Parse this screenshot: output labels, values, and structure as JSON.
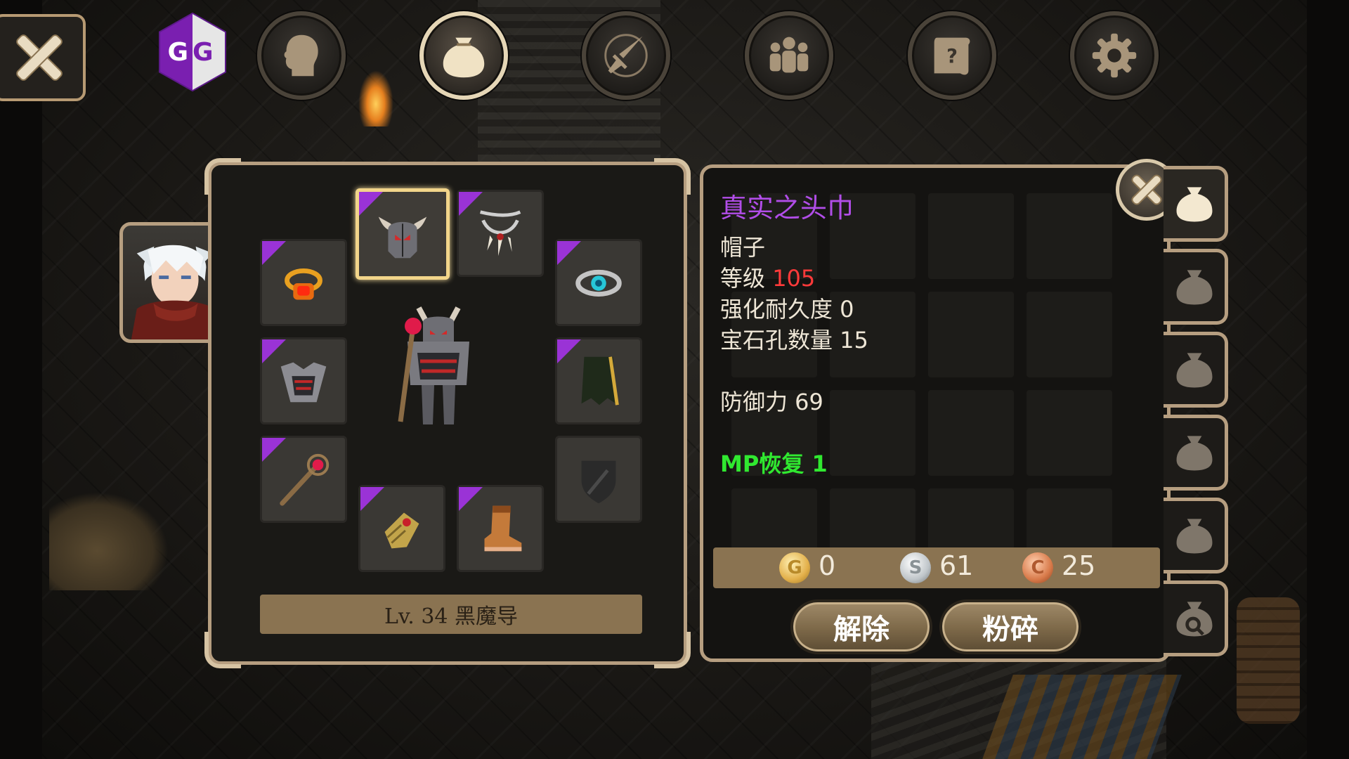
{
  "top_bar": {
    "logo_text_left": "G",
    "logo_text_right": "G",
    "tabs": [
      {
        "icon": "head-icon",
        "active": false
      },
      {
        "icon": "bag-icon",
        "active": true
      },
      {
        "icon": "sword-compass-icon",
        "active": false
      },
      {
        "icon": "party-icon",
        "active": false
      },
      {
        "icon": "quest-scroll-icon",
        "active": false
      },
      {
        "icon": "gear-icon",
        "active": false
      }
    ]
  },
  "equipment": {
    "class_label": "Lv. 34 黑魔导",
    "slots": [
      {
        "name": "helmet",
        "icon": "horned-helmet-icon",
        "rarity": "epic",
        "selected": true
      },
      {
        "name": "necklace",
        "icon": "claw-necklace-icon",
        "rarity": "epic"
      },
      {
        "name": "ring-left",
        "icon": "fire-ring-icon",
        "rarity": "epic"
      },
      {
        "name": "ring-right",
        "icon": "blue-gem-ring-icon",
        "rarity": "epic"
      },
      {
        "name": "armor",
        "icon": "spiked-armor-icon",
        "rarity": "epic"
      },
      {
        "name": "cape",
        "icon": "cape-icon",
        "rarity": "epic"
      },
      {
        "name": "weapon",
        "icon": "staff-icon",
        "rarity": "epic"
      },
      {
        "name": "offhand",
        "icon": "shield-placeholder-icon",
        "rarity": "none"
      },
      {
        "name": "gloves",
        "icon": "gauntlet-icon",
        "rarity": "epic"
      },
      {
        "name": "boots",
        "icon": "boots-icon",
        "rarity": "epic"
      }
    ]
  },
  "item_info": {
    "name": "真实之头巾",
    "type": "帽子",
    "level_label": "等级",
    "level_value": "105",
    "durability": "强化耐久度 0",
    "sockets": "宝石孔数量 15",
    "defense": "防御力 69",
    "bonus": "MP恢复 1"
  },
  "currency": {
    "gold": "0",
    "silver": "61",
    "copper": "25",
    "gold_symbol": "G",
    "silver_symbol": "S",
    "copper_symbol": "C"
  },
  "actions": {
    "unequip_label": "解除",
    "shatter_label": "粉碎"
  },
  "colors": {
    "item_name": "#b14de8",
    "level_value": "#ff3a3a",
    "bonus_stat": "#30e830",
    "rarity_epic": "#9a33d6",
    "selected_border": "#f2d58a",
    "panel_border": "#b69e80"
  }
}
